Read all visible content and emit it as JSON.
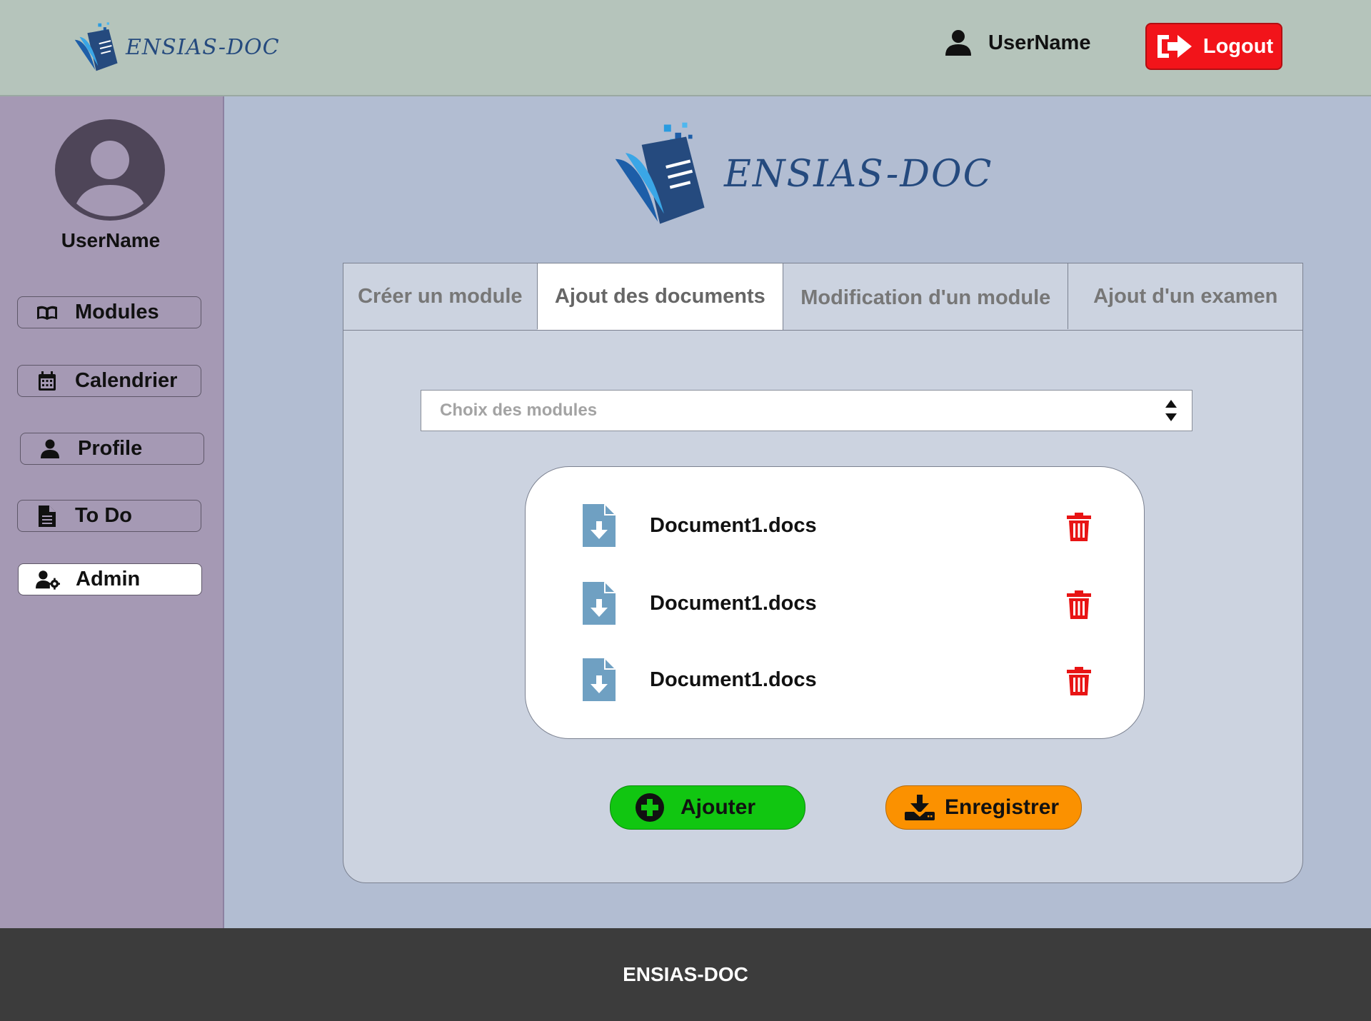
{
  "header": {
    "brand": "ENSIAS-DOC",
    "username": "UserName",
    "logout_label": "Logout"
  },
  "sidebar": {
    "username": "UserName",
    "items": [
      {
        "label": "Modules",
        "icon": "book-icon"
      },
      {
        "label": "Calendrier",
        "icon": "calendar-icon"
      },
      {
        "label": "Profile",
        "icon": "user-icon"
      },
      {
        "label": "To Do",
        "icon": "file-text-icon"
      },
      {
        "label": "Admin",
        "icon": "user-gear-icon",
        "active": true
      }
    ]
  },
  "main": {
    "brand": "ENSIAS-DOC",
    "tabs": [
      {
        "label": "Créer un module"
      },
      {
        "label": "Ajout des documents",
        "active": true
      },
      {
        "label": "Modification d'un module"
      },
      {
        "label": "Ajout d'un examen"
      }
    ],
    "select": {
      "placeholder": "Choix des modules"
    },
    "documents": [
      {
        "name": "Document1.docs"
      },
      {
        "name": "Document1.docs"
      },
      {
        "name": "Document1.docs"
      }
    ],
    "add_label": "Ajouter",
    "save_label": "Enregistrer"
  },
  "footer": {
    "text": "ENSIAS-DOC"
  },
  "colors": {
    "topbar": "#b5c4bb",
    "sidebar": "#a599b4",
    "main_bg": "#b2bdd2",
    "logout": "#f2141a",
    "add": "#11c611",
    "save": "#fb9100",
    "trash": "#e81414",
    "file_icon": "#6fa0c2",
    "brand": "#254a7e"
  }
}
